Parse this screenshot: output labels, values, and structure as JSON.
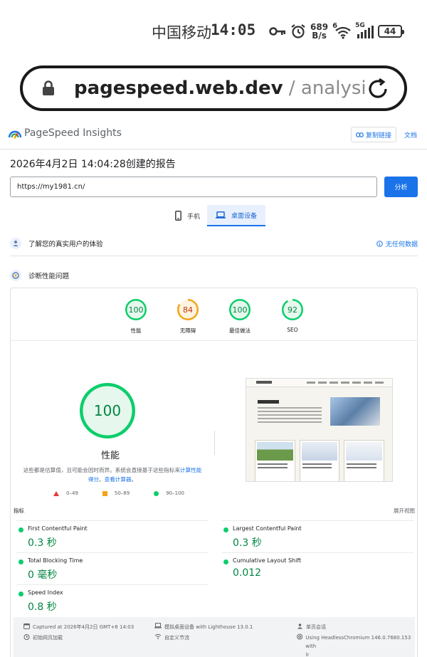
{
  "status_bar": {
    "carrier": "中国移动",
    "time": "14:05",
    "net_speed_value": "689",
    "net_speed_unit": "B/s",
    "wifi_badge": "6",
    "cell_badge": "5G",
    "battery": "44"
  },
  "browser": {
    "url_domain": "pagespeed.web.dev",
    "url_path": "/ analysis / htt"
  },
  "header": {
    "title": "PageSpeed Insights",
    "copy_link": "复制链接",
    "docs": "文档"
  },
  "report": {
    "title": "2026年4月2日 14:04:28创建的报告",
    "url_value": "https://my1981.cn/",
    "analyze": "分析"
  },
  "tabs": [
    {
      "label": "手机"
    },
    {
      "label": "桌面设备"
    }
  ],
  "crux": {
    "label": "了解您的真实用户的体验",
    "no_data": "无任何数据"
  },
  "diagnose": {
    "label": "诊断性能问题"
  },
  "scores": [
    {
      "label": "性能",
      "value": 100,
      "color": "#0cce6b"
    },
    {
      "label": "无障碍",
      "value": 84,
      "color": "#f2a51a"
    },
    {
      "label": "最佳做法",
      "value": 100,
      "color": "#0cce6b"
    },
    {
      "label": "SEO",
      "value": 92,
      "color": "#0cce6b"
    }
  ],
  "performance": {
    "score": "100",
    "score_value": 100,
    "title": "性能",
    "desc_prefix": "这些都是估算值，且可能会因时而异。系统会直接基于这些指标来",
    "desc_link1": "计算性能得分",
    "desc_sep": "。",
    "desc_link2": "查看计算器",
    "desc_end": "。"
  },
  "legend": [
    {
      "label": "0–49"
    },
    {
      "label": "50–89"
    },
    {
      "label": "90–100"
    }
  ],
  "metrics_header": {
    "label": "指标",
    "expand": "展开视图"
  },
  "metrics": [
    {
      "name": "First Contentful Paint",
      "value": "0.3 秒"
    },
    {
      "name": "Largest Contentful Paint",
      "value": "0.3 秒"
    },
    {
      "name": "Total Blocking Time",
      "value": "0 毫秒"
    },
    {
      "name": "Cumulative Layout Shift",
      "value": "0.012"
    },
    {
      "name": "Speed Index",
      "value": "0.8 秒"
    }
  ],
  "footer": {
    "captured": "Captured at 2026年4月2日 GMT+8 14:03",
    "initial_load": "初始网页加载",
    "emulated": "模拟桌面设备 with Lighthouse 13.0.1",
    "throttling": "自定义节流",
    "session": "单页会话",
    "browser_line1": "Using HeadlessChromium 146.0.7680.153 with",
    "browser_line2": "lr"
  }
}
